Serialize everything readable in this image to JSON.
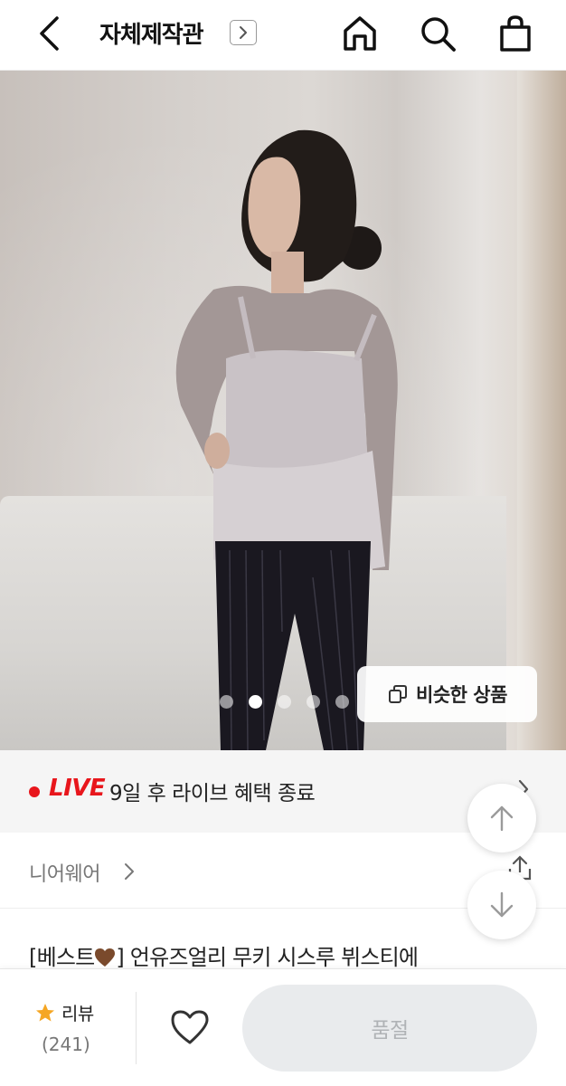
{
  "header": {
    "store_name": "자체제작관",
    "icons": [
      "back-icon",
      "store-link-icon",
      "home-icon",
      "search-icon",
      "shopping-bag-icon"
    ]
  },
  "gallery": {
    "slide_count": 5,
    "active_slide": 2,
    "similar_products_label": "비슷한 상품"
  },
  "live_banner": {
    "badge": "LIVE",
    "text": "9일 후 라이브 혜택 종료",
    "accent_color": "#e8161c"
  },
  "brand": {
    "name": "니어웨어"
  },
  "product": {
    "title_prefix": "[베스트",
    "title_suffix": "] 언유즈얼리 무키 시스루 뷔스티에"
  },
  "bottom_bar": {
    "review_label": "리뷰",
    "review_count": "(241)",
    "soldout_label": "품절"
  }
}
